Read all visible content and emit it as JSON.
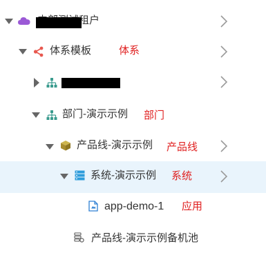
{
  "tree": {
    "items": [
      {
        "label": "内部测试租户",
        "level": 0,
        "expanded": true,
        "icon": "cloud-icon",
        "redacted": true,
        "note": ""
      },
      {
        "label": "体系模板",
        "level": 1,
        "expanded": true,
        "icon": "share-icon",
        "note": "体系"
      },
      {
        "label": "",
        "level": 2,
        "expanded": false,
        "icon": "org-icon",
        "redacted": true,
        "note": ""
      },
      {
        "label": "部门-演示示例",
        "level": 2,
        "expanded": true,
        "icon": "org-icon",
        "note": "部门"
      },
      {
        "label": "产品线-演示示例",
        "level": 3,
        "expanded": true,
        "icon": "box-icon",
        "note": "产品线"
      },
      {
        "label": "系统-演示示例",
        "level": 4,
        "expanded": true,
        "icon": "server-icon",
        "note": "系统",
        "selected": true
      },
      {
        "label": "app-demo-1",
        "level": 5,
        "expanded": null,
        "icon": "app-file-icon",
        "note": "应用"
      },
      {
        "label": "产品线-演示示例备机池",
        "level": 3,
        "expanded": null,
        "icon": "machine-pool-icon",
        "note": ""
      }
    ]
  },
  "colors": {
    "selected_bg": "#e9f4fc",
    "annotation_red": "#e02020",
    "text": "#333333",
    "cloud_purple": "#9b59d6",
    "share_red": "#e8584f",
    "org_teal": "#3a9b8e",
    "box_olive": "#b39a3a",
    "server_blue": "#2d9cdb"
  }
}
